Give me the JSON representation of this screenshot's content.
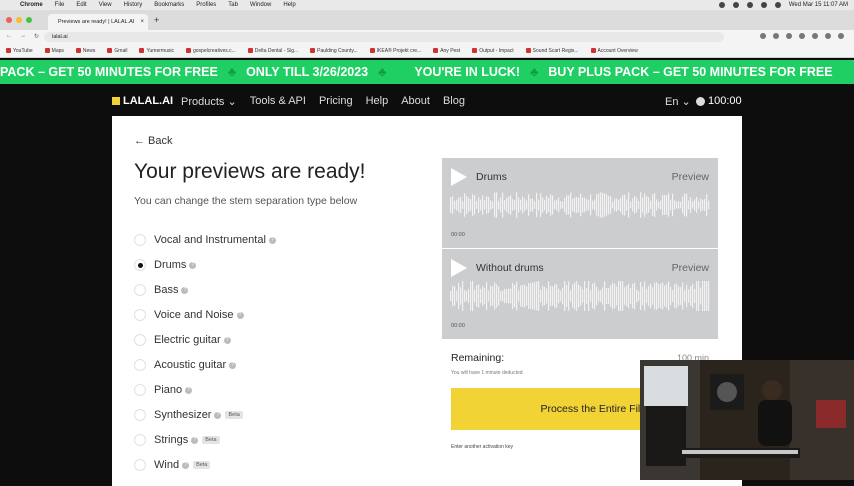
{
  "macos_menu": {
    "apple": "",
    "app": "Chrome",
    "items": [
      "File",
      "Edit",
      "View",
      "History",
      "Bookmarks",
      "Profiles",
      "Tab",
      "Window",
      "Help"
    ],
    "clock": "Wed Mar 15  11:07 AM"
  },
  "browser": {
    "tab_title": "Previews are ready! | LALAL.AI",
    "tab_close": "×",
    "new_tab": "+",
    "url": "lalal.ai",
    "nav": [
      "←",
      "→",
      "↻"
    ],
    "bookmarks": [
      "YouTube",
      "Maps",
      "News",
      "Gmail",
      "Yumermusic",
      "gospelcreatives.c...",
      "Delta Dental - Sig...",
      "Paulding County...",
      "IKEA® Projekt cre...",
      "Any Pest",
      "Output - Impact",
      "Sound Scart Regis...",
      "Account Overview"
    ]
  },
  "banner": {
    "seg1": "PACK – GET 50 MINUTES FOR FREE",
    "seg2": "ONLY TILL 3/26/2023",
    "seg3": "YOU'RE IN LUCK!",
    "seg4": "BUY PLUS PACK – GET 50 MINUTES FOR FREE",
    "clover": "♣",
    "bg_color": "#1fcf63"
  },
  "header": {
    "logo": "LALAL.AI",
    "nav": [
      "Products",
      "Tools & API",
      "Pricing",
      "Help",
      "About",
      "Blog"
    ],
    "products_chevron": "⌄",
    "lang": "En",
    "lang_chevron": "⌄",
    "credits": "100:00"
  },
  "main": {
    "back": "← Back",
    "title": "Your previews are ready!",
    "subtitle": "You can change the stem separation type below",
    "options": [
      {
        "label": "Vocal and Instrumental",
        "selected": false,
        "beta": false
      },
      {
        "label": "Drums",
        "selected": true,
        "beta": false
      },
      {
        "label": "Bass",
        "selected": false,
        "beta": false
      },
      {
        "label": "Voice and Noise",
        "selected": false,
        "beta": false
      },
      {
        "label": "Electric guitar",
        "selected": false,
        "beta": false
      },
      {
        "label": "Acoustic guitar",
        "selected": false,
        "beta": false
      },
      {
        "label": "Piano",
        "selected": false,
        "beta": false
      },
      {
        "label": "Synthesizer",
        "selected": false,
        "beta": true
      },
      {
        "label": "Strings",
        "selected": false,
        "beta": true
      },
      {
        "label": "Wind",
        "selected": false,
        "beta": true
      }
    ],
    "help_glyph": "?",
    "beta_label": "Beta"
  },
  "previews": [
    {
      "name": "Drums",
      "action": "Preview",
      "time": "00:00"
    },
    {
      "name": "Without drums",
      "action": "Preview",
      "time": "00:00"
    }
  ],
  "process": {
    "remaining_label": "Remaining:",
    "remaining_value": "100 min",
    "note": "You will have 1 minute deducted",
    "button": "Process the Entire File →",
    "another": "Enter another activation key",
    "button_color": "#f2d335"
  }
}
